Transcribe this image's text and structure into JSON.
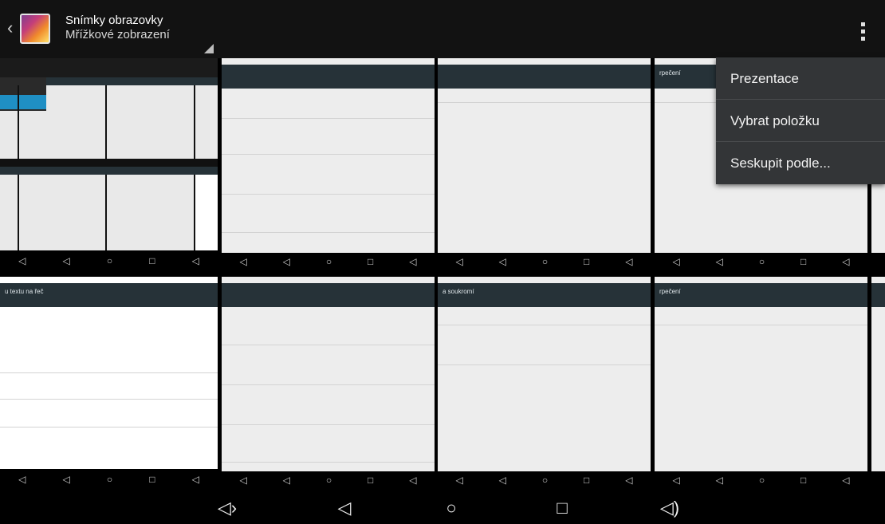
{
  "actionbar": {
    "title": "Snímky obrazovky",
    "subtitle": "Mřížkové zobrazení",
    "icons": {
      "up": "chevron-left-icon",
      "app": "gallery-app-icon",
      "overflow": "overflow-menu-icon"
    }
  },
  "menu": {
    "items": [
      "Prezentace",
      "Vybrat položku",
      "Seskupit podle..."
    ]
  },
  "thumbnails": {
    "row1": [
      "",
      "",
      "",
      "rpečení"
    ],
    "row2": [
      "u textu na řeč",
      "",
      "a soukromí",
      "rpečení"
    ]
  },
  "navbar": {
    "icons": [
      "volume-down-icon",
      "back-icon",
      "home-icon",
      "recents-icon",
      "volume-up-icon"
    ]
  },
  "colors": {
    "actionbar": "#121212",
    "menu": "#333537",
    "tile_header": "#263238",
    "tile_bg": "#ededed"
  }
}
